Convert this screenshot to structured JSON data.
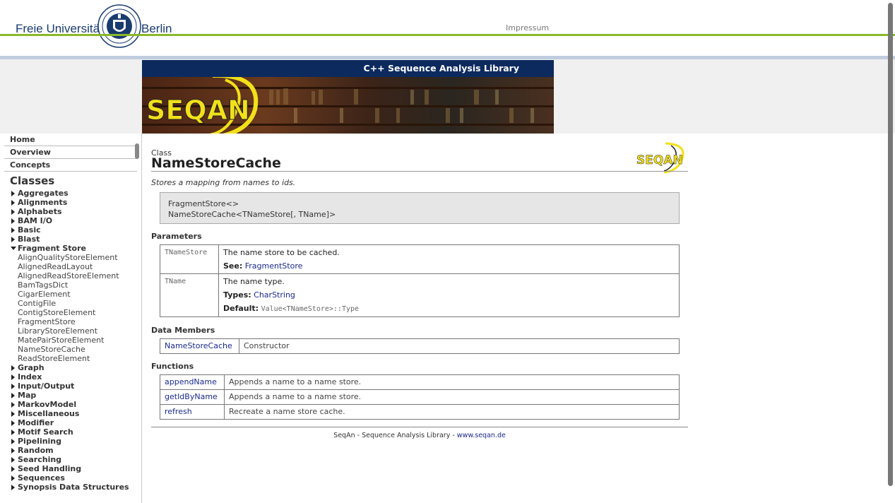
{
  "header": {
    "university_word1": "Freie Universität",
    "university_word2": "Berlin",
    "impressum": "Impressum"
  },
  "banner": {
    "title": "C++ Sequence Analysis Library",
    "logo_text": "SEQAN"
  },
  "sidebar": {
    "top_links": [
      "Home",
      "Overview",
      "Concepts"
    ],
    "classes_heading": "Classes",
    "groups": [
      {
        "label": "Aggregates",
        "open": false
      },
      {
        "label": "Alignments",
        "open": false
      },
      {
        "label": "Alphabets",
        "open": false
      },
      {
        "label": "BAM I/O",
        "open": false
      },
      {
        "label": "Basic",
        "open": false
      },
      {
        "label": "Blast",
        "open": false
      },
      {
        "label": "Fragment Store",
        "open": true
      },
      {
        "label": "Graph",
        "open": false
      },
      {
        "label": "Index",
        "open": false
      },
      {
        "label": "Input/Output",
        "open": false
      },
      {
        "label": "Map",
        "open": false
      },
      {
        "label": "MarkovModel",
        "open": false
      },
      {
        "label": "Miscellaneous",
        "open": false
      },
      {
        "label": "Modifier",
        "open": false
      },
      {
        "label": "Motif Search",
        "open": false
      },
      {
        "label": "Pipelining",
        "open": false
      },
      {
        "label": "Random",
        "open": false
      },
      {
        "label": "Searching",
        "open": false
      },
      {
        "label": "Seed Handling",
        "open": false
      },
      {
        "label": "Sequences",
        "open": false
      },
      {
        "label": "Synopsis Data Structures",
        "open": false
      }
    ],
    "fragment_store_children": [
      "AlignQualityStoreElement",
      "AlignedReadLayout",
      "AlignedReadStoreElement",
      "BamTagsDict",
      "CigarElement",
      "ContigFile",
      "ContigStoreElement",
      "FragmentStore",
      "LibraryStoreElement",
      "MatePairStoreElement",
      "NameStoreCache",
      "ReadStoreElement"
    ]
  },
  "main": {
    "kind": "Class",
    "title": "NameStoreCache",
    "summary": "Stores a mapping from names to ids.",
    "signature": [
      "FragmentStore<>",
      "NameStoreCache<TNameStore[, TName]>"
    ],
    "parameters_heading": "Parameters",
    "parameters": [
      {
        "name": "TNameStore",
        "description": "The name store to be cached.",
        "see_label": "See:",
        "see_value": "FragmentStore"
      },
      {
        "name": "TName",
        "description": "The name type.",
        "types_label": "Types:",
        "types_value": "CharString",
        "default_label": "Default:",
        "default_value": "Value<TNameStore>::Type"
      }
    ],
    "data_members_heading": "Data Members",
    "data_members": [
      {
        "name": "NameStoreCache",
        "description": "Constructor"
      }
    ],
    "functions_heading": "Functions",
    "functions": [
      {
        "name": "appendName",
        "description": "Appends a name to a name store."
      },
      {
        "name": "getIdByName",
        "description": "Appends a name to a name store."
      },
      {
        "name": "refresh",
        "description": "Recreate a name store cache."
      }
    ],
    "footer_text": "SeqAn - Sequence Analysis Library - ",
    "footer_link": "www.seqan.de"
  },
  "colors": {
    "fu_green": "#8ab82a",
    "banner_navy": "#0c2a5e",
    "link": "#1a2a88",
    "seqan_yellow": "#f2e01a"
  }
}
